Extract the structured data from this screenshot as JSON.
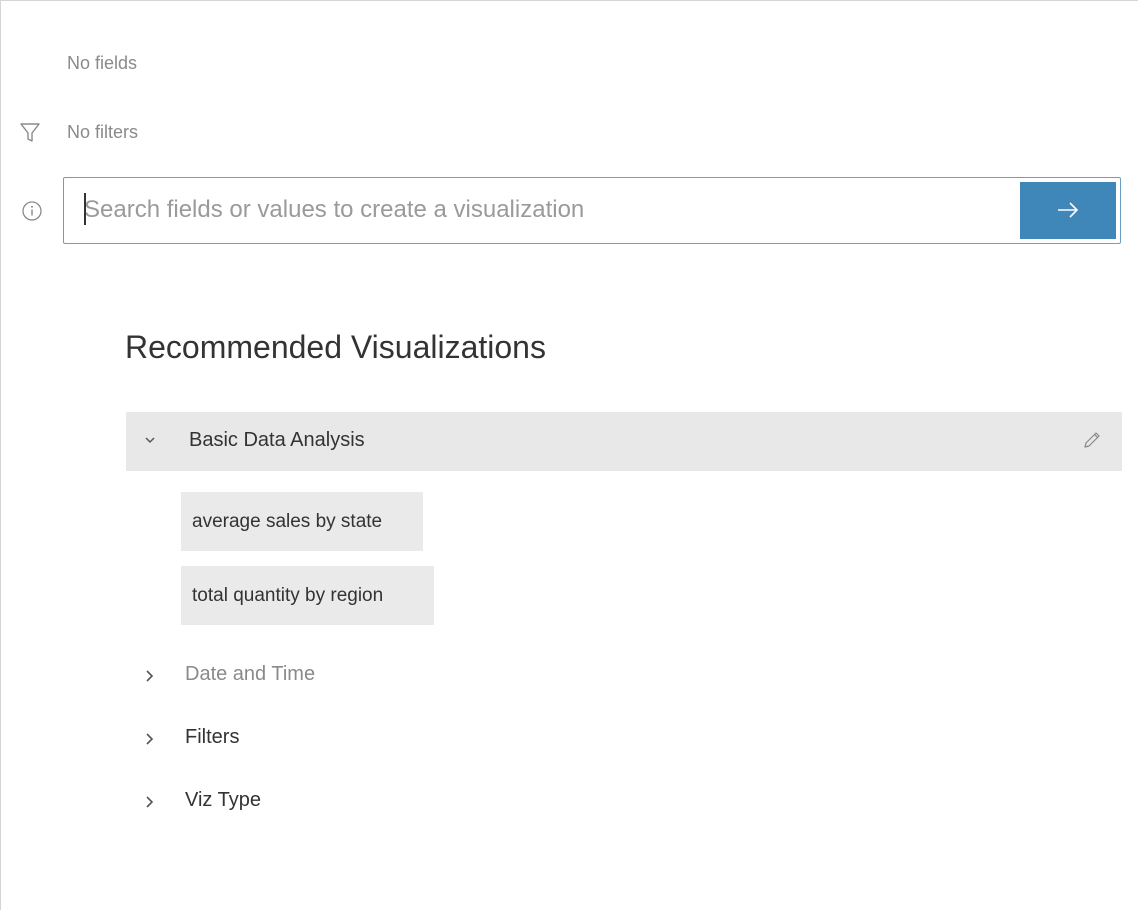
{
  "fields_status": "No fields",
  "filters_status": "No filters",
  "search": {
    "placeholder": "Search fields or values to create a visualization",
    "value": "",
    "submit_icon": "arrow-right-icon"
  },
  "recommended": {
    "title": "Recommended Visualizations",
    "groups": [
      {
        "label": "Basic Data Analysis",
        "expanded": true,
        "items": [
          "average sales by state",
          "total quantity by region"
        ]
      },
      {
        "label": "Date and Time",
        "expanded": false
      },
      {
        "label": "Filters",
        "expanded": false
      },
      {
        "label": "Viz Type",
        "expanded": false
      }
    ]
  },
  "colors": {
    "accent": "#3f86b9",
    "focus_border": "#6aa0c8",
    "header_bg": "#e8e8e8",
    "chip_bg": "#eaeaea"
  }
}
